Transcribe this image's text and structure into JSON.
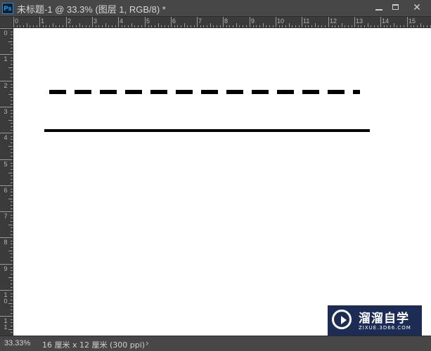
{
  "window": {
    "app_icon_text": "Ps",
    "title": "未标题-1 @ 33.3% (图层 1, RGB/8) *",
    "minimize_icon": "minimize-icon",
    "maximize_icon": "maximize-icon",
    "close_label": "✕"
  },
  "ruler_h": {
    "labels": [
      "0",
      "1",
      "2",
      "3",
      "4",
      "5",
      "6",
      "7",
      "8",
      "9",
      "10",
      "11",
      "12",
      "13",
      "14",
      "15"
    ]
  },
  "ruler_v": {
    "labels": [
      "0",
      "1",
      "2",
      "3",
      "4",
      "5",
      "6",
      "7",
      "8",
      "9",
      "10",
      "11"
    ]
  },
  "canvas": {
    "background": "#ffffff",
    "line_color": "#000000"
  },
  "watermark": {
    "text": "溜溜自学",
    "url": "ZIXUE.3D66.COM"
  },
  "status": {
    "zoom": "33.33%",
    "doc_info": "16 厘米 x 12 厘米 (300 ppi)",
    "arrow": "›"
  }
}
